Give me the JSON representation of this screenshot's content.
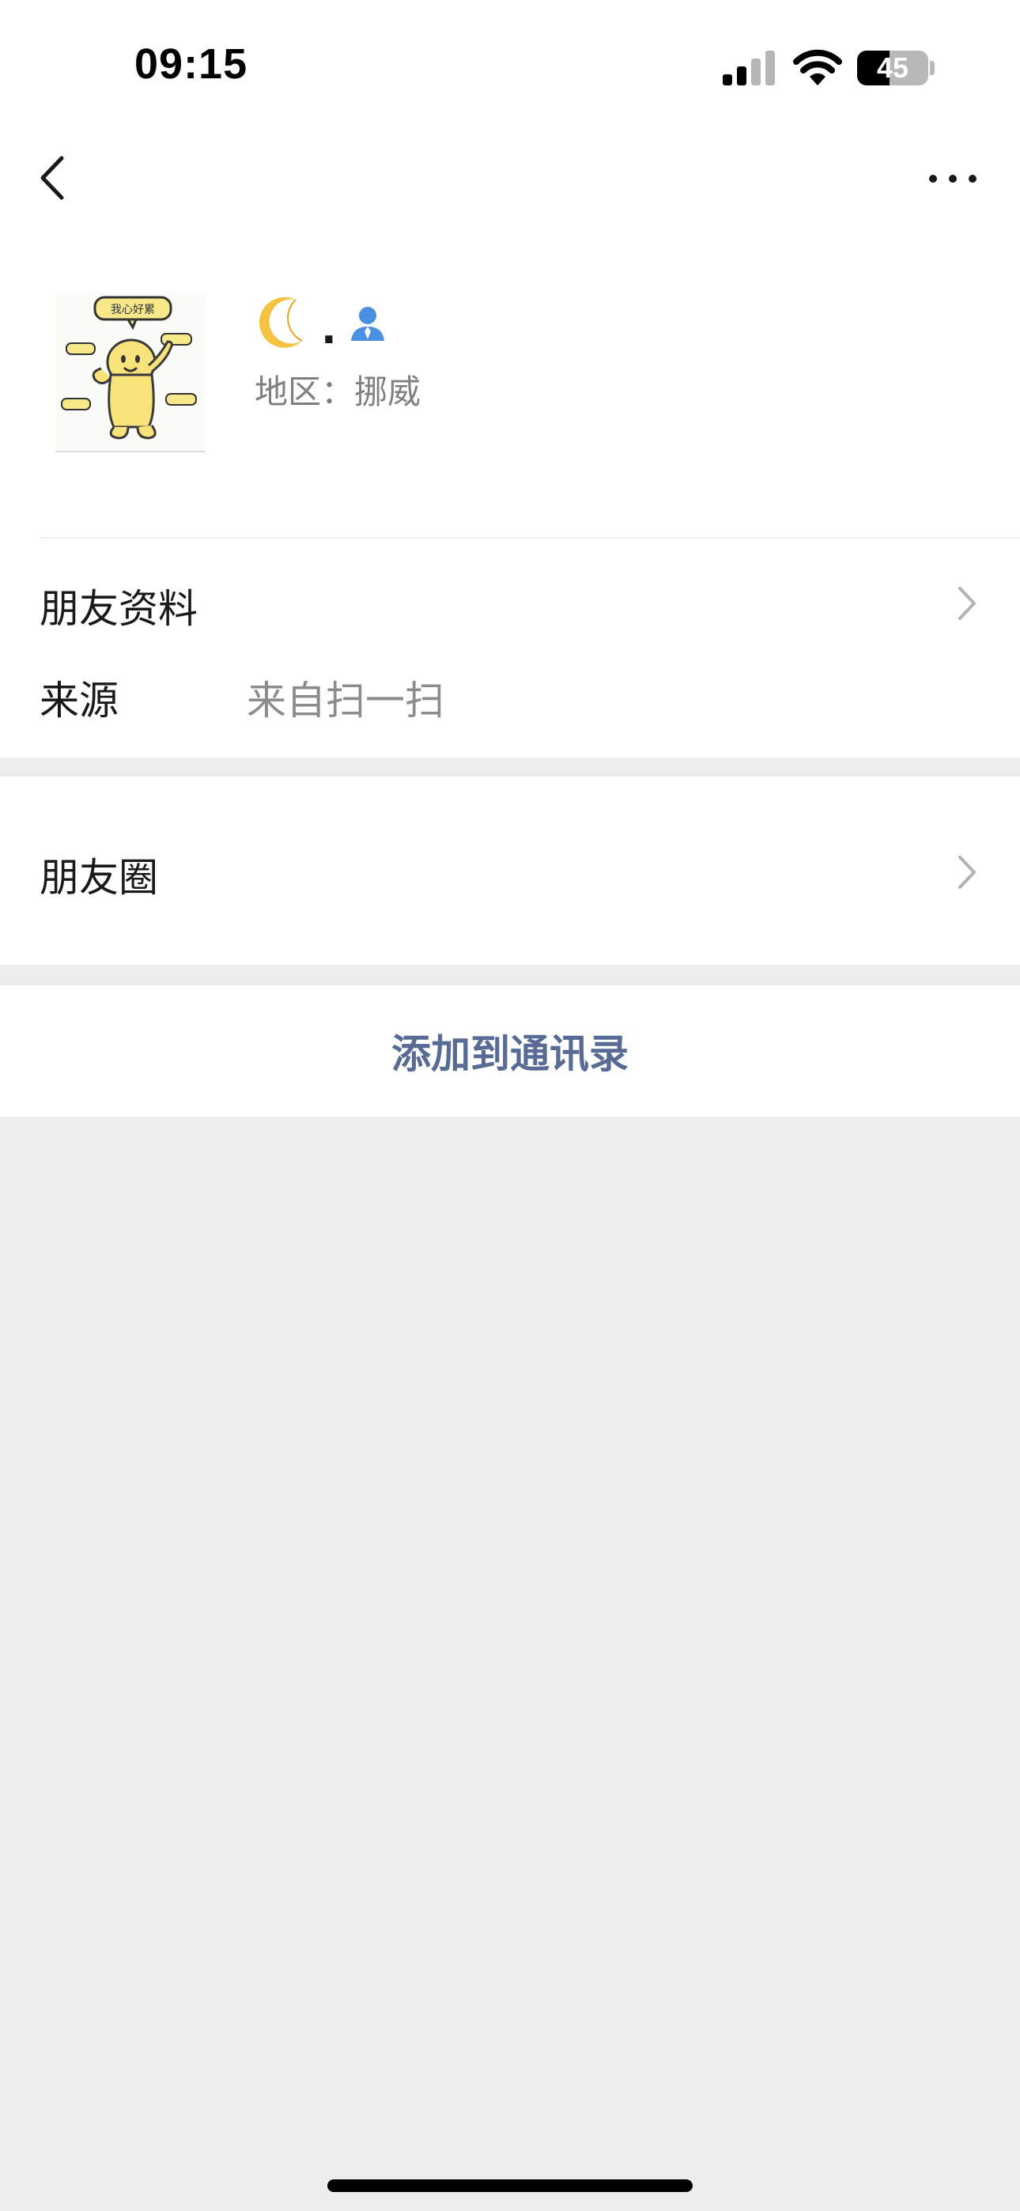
{
  "status_bar": {
    "time": "09:15",
    "battery_level": "45",
    "battery_percent": 45
  },
  "nav": {
    "back_icon": "chevron-left-icon",
    "more_icon": "more-dots-icon"
  },
  "profile": {
    "avatar_text": "我心好累",
    "name_emoji": "crescent-moon-icon",
    "name_suffix": ".",
    "contact_badge_icon": "person-badge-icon",
    "region": "地区：挪威"
  },
  "details": {
    "friend_info_label": "朋友资料",
    "source_label": "来源",
    "source_value": "来自扫一扫"
  },
  "moments": {
    "label": "朋友圈"
  },
  "actions": {
    "add_to_contacts": "添加到通讯录"
  },
  "colors": {
    "accent_link": "#576b95",
    "background": "#ededed",
    "badge_blue": "#4a90e2"
  }
}
